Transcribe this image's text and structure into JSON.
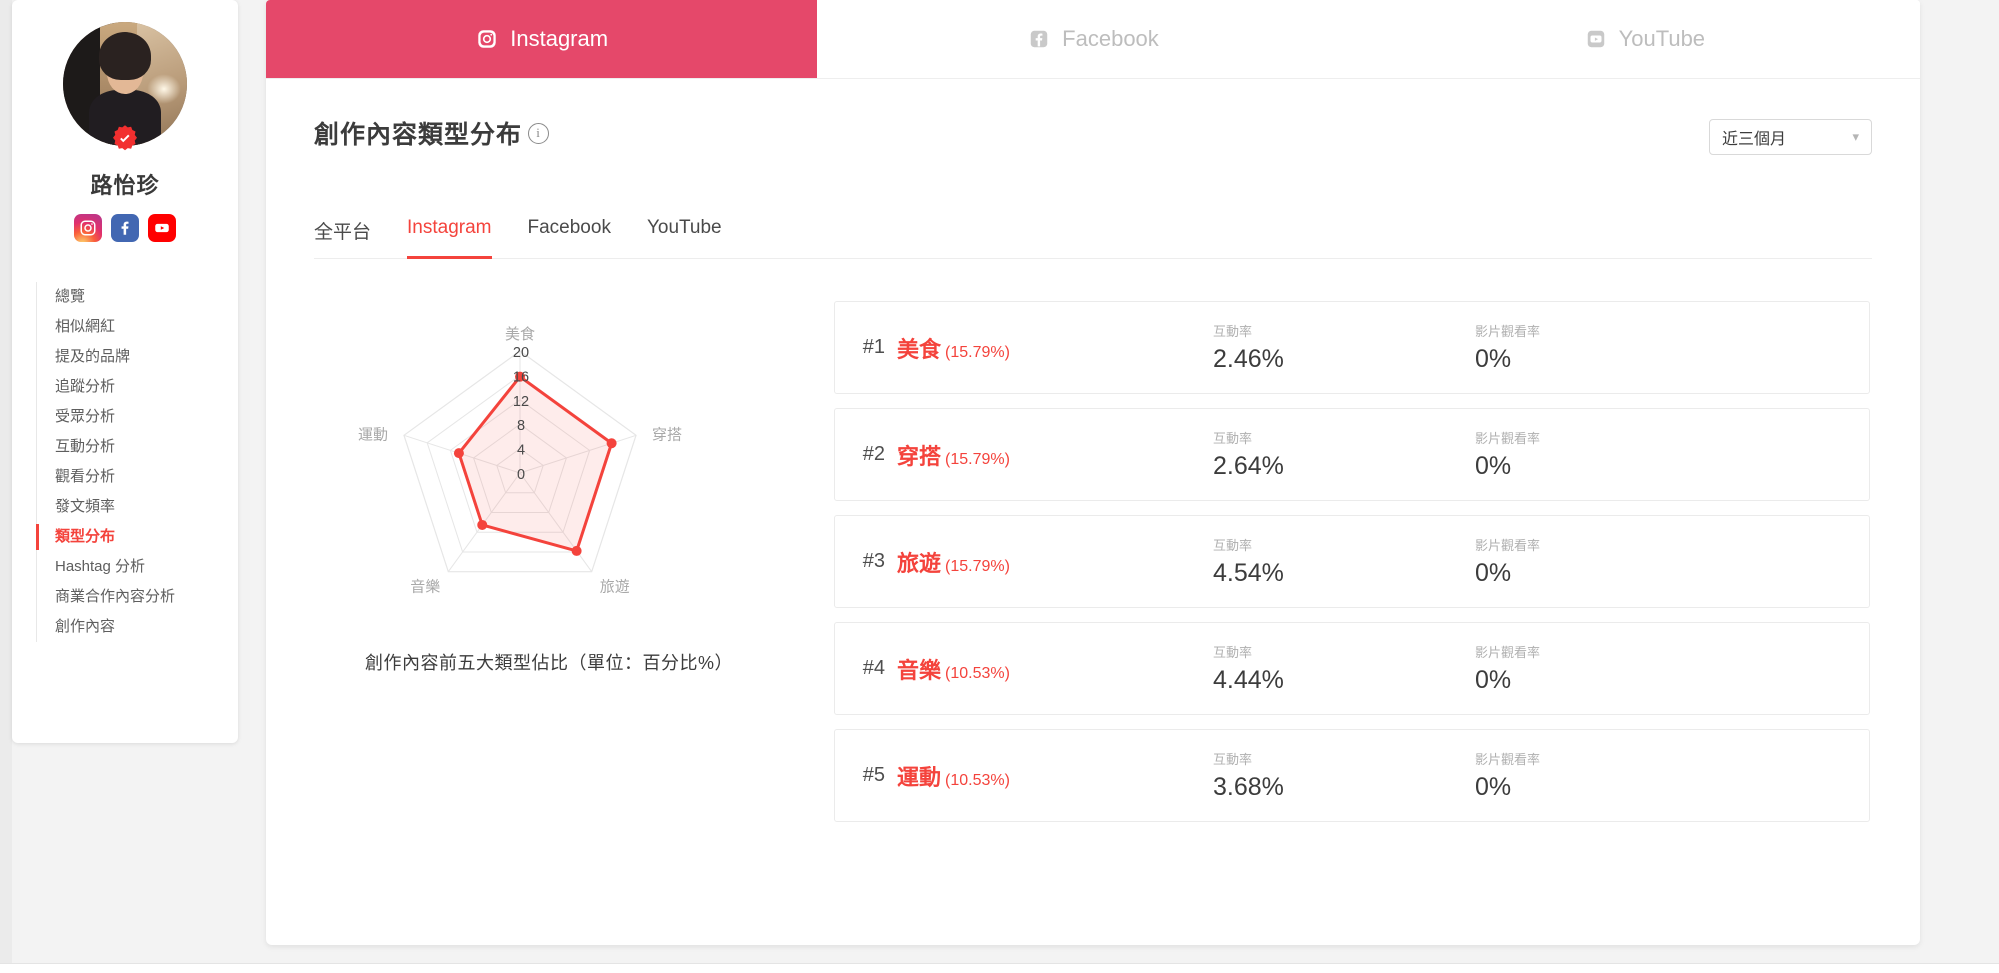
{
  "profile": {
    "name": "路怡珍",
    "verified_badge": "verified-badge",
    "socials": [
      {
        "id": "instagram",
        "label": "Instagram",
        "color": "#E1306C"
      },
      {
        "id": "facebook",
        "label": "Facebook",
        "color": "#4267B2"
      },
      {
        "id": "youtube",
        "label": "YouTube",
        "color": "#FF0000"
      }
    ]
  },
  "sidebar": {
    "items": [
      {
        "label": "總覽",
        "active": false
      },
      {
        "label": "相似網紅",
        "active": false
      },
      {
        "label": "提及的品牌",
        "active": false
      },
      {
        "label": "追蹤分析",
        "active": false
      },
      {
        "label": "受眾分析",
        "active": false
      },
      {
        "label": "互動分析",
        "active": false
      },
      {
        "label": "觀看分析",
        "active": false
      },
      {
        "label": "發文頻率",
        "active": false
      },
      {
        "label": "類型分布",
        "active": true
      },
      {
        "label": "Hashtag 分析",
        "active": false
      },
      {
        "label": "商業合作內容分析",
        "active": false
      },
      {
        "label": "創作內容",
        "active": false
      }
    ]
  },
  "platform_tabs": [
    {
      "label": "Instagram",
      "icon": "instagram-icon",
      "active": true
    },
    {
      "label": "Facebook",
      "icon": "facebook-icon",
      "active": false
    },
    {
      "label": "YouTube",
      "icon": "youtube-icon",
      "active": false
    }
  ],
  "panel": {
    "title": "創作內容類型分布",
    "info_icon": "info-icon",
    "range_value": "近三個月",
    "range_chevron": "chevron-down-icon",
    "subtabs": [
      {
        "label": "全平台",
        "active": false
      },
      {
        "label": "Instagram",
        "active": true
      },
      {
        "label": "Facebook",
        "active": false
      },
      {
        "label": "YouTube",
        "active": false
      }
    ]
  },
  "chart_data": {
    "type": "radar",
    "title": "創作內容前五大類型佔比（單位：百分比%）",
    "categories": [
      "美食",
      "穿搭",
      "旅遊",
      "音樂",
      "運動"
    ],
    "values": [
      15.79,
      15.79,
      15.79,
      10.53,
      10.53
    ],
    "tick_labels": [
      "0",
      "4",
      "8",
      "12",
      "16",
      "20"
    ],
    "ticks": [
      0,
      4,
      8,
      12,
      16,
      20
    ],
    "rlim": [
      0,
      20
    ],
    "grid": true,
    "legend": "none",
    "series_color": "#f4433c",
    "fill_color": "rgba(244,67,60,0.10)",
    "ylabel": "",
    "xlabel": ""
  },
  "ranking": {
    "metric_labels": {
      "engagement": "互動率",
      "view": "影片觀看率"
    },
    "rows": [
      {
        "rank": "#1",
        "category": "美食",
        "share": "(15.79%)",
        "engagement": "2.46%",
        "view_rate": "0%"
      },
      {
        "rank": "#2",
        "category": "穿搭",
        "share": "(15.79%)",
        "engagement": "2.64%",
        "view_rate": "0%"
      },
      {
        "rank": "#3",
        "category": "旅遊",
        "share": "(15.79%)",
        "engagement": "4.54%",
        "view_rate": "0%"
      },
      {
        "rank": "#4",
        "category": "音樂",
        "share": "(10.53%)",
        "engagement": "4.44%",
        "view_rate": "0%"
      },
      {
        "rank": "#5",
        "category": "運動",
        "share": "(10.53%)",
        "engagement": "3.68%",
        "view_rate": "0%"
      }
    ]
  }
}
